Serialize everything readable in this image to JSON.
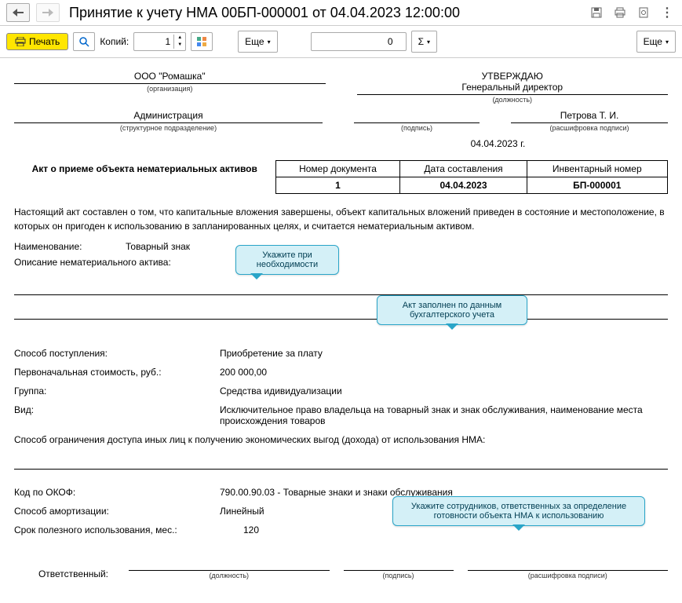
{
  "header": {
    "title": "Принятие к учету НМА 00БП-000001 от 04.04.2023 12:00:00"
  },
  "toolbar": {
    "print": "Печать",
    "copies_label": "Копий:",
    "copies_value": "1",
    "more": "Еще",
    "sum_value": "0",
    "sigma": "Σ",
    "more_right": "Еще"
  },
  "doc": {
    "approve": "УТВЕРЖДАЮ",
    "org": "ООО \"Ромашка\"",
    "org_sub": "(организация)",
    "position": "Генеральный директор",
    "position_sub": "(должность)",
    "department": "Администрация",
    "department_sub": "(структурное подразделение)",
    "sign_sub": "(подпись)",
    "person": "Петрова Т. И.",
    "person_sub": "(расшифровка подписи)",
    "date": "04.04.2023 г.",
    "table": {
      "title": "Акт о приеме объекта нематериальных активов",
      "h1": "Номер документа",
      "h2": "Дата составления",
      "h3": "Инвентарный номер",
      "v1": "1",
      "v2": "04.04.2023",
      "v3": "БП-000001"
    },
    "body": "Настоящий акт составлен о том, что капитальные вложения завершены, объект капитальных вложений приведен в состояние и местоположение, в которых он пригоден к использованию в запланированных целях, и считается нематериальным активом.",
    "name_label": "Наименование:",
    "name_val": "Товарный знак",
    "desc_label": "Описание нематериального актива:",
    "method_label": "Способ поступления:",
    "method_val": "Приобретение за плату",
    "cost_label": "Первоначальная стоимость, руб.:",
    "cost_val": "200 000,00",
    "group_label": "Группа:",
    "group_val": "Средства идивидуализации",
    "type_label": "Вид:",
    "type_val": "Исключительное право владельца на товарный знак и знак обслуживания, наименование места происхождения товаров",
    "restrict": "Способ ограничения доступа иных лиц к получению экономических выгод (дохода) от использования НМА:",
    "okof_label": "Код по ОКОФ:",
    "okof_val": "790.00.90.03 - Товарные знаки и знаки обслуживания",
    "amort_label": "Способ амортизации:",
    "amort_val": "Линейный",
    "life_label": "Срок полезного использования, мес.:",
    "life_val": "120",
    "resp_label": "Ответственный:",
    "resp_pos_sub": "(должность)",
    "resp_sign_sub": "(подпись)",
    "resp_name_sub": "(расшифровка подписи)"
  },
  "callouts": {
    "c1": "Укажите при необходимости",
    "c2": "Акт заполнен по данным бухгалтерского учета",
    "c3": "Укажите сотрудников, ответственных за определение готовности объекта НМА к использованию"
  }
}
